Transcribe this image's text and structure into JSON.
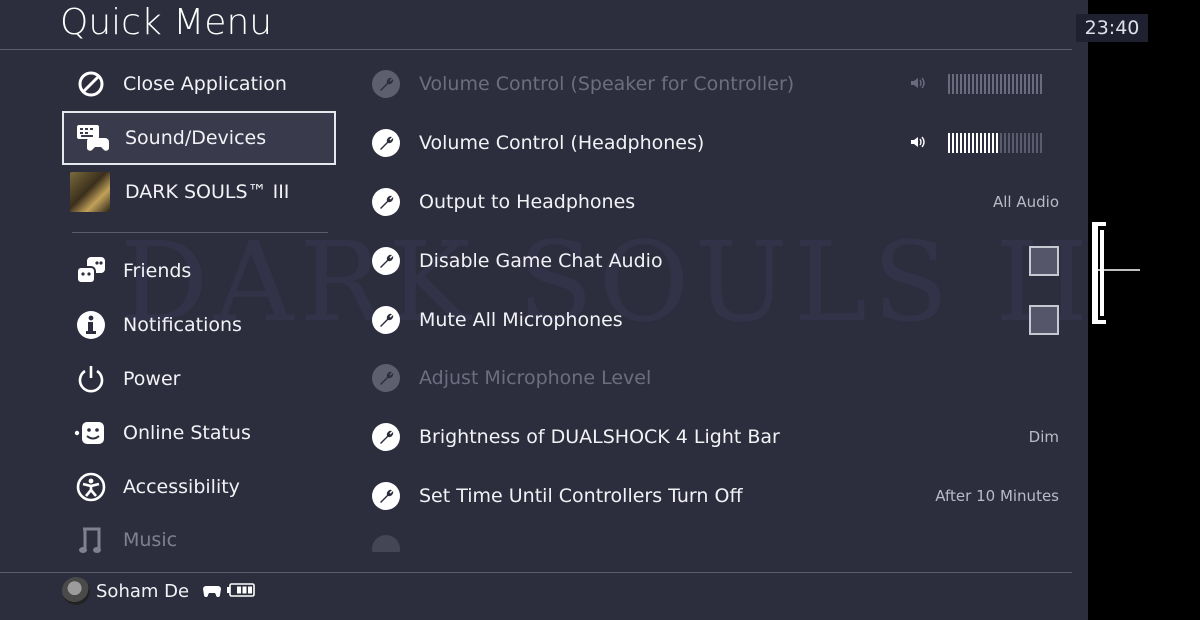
{
  "header": {
    "title": "Quick Menu",
    "clock": "23:40"
  },
  "background": {
    "watermark": "DARK SOULS III"
  },
  "left_menu": {
    "items": [
      {
        "label": "Close Application",
        "icon": "prohibited-circle-icon"
      },
      {
        "label": "Sound/Devices",
        "icon": "keyboard-controller-icon",
        "selected": true
      },
      {
        "label": "DARK SOULS™ III",
        "icon": "game-thumbnail"
      },
      {
        "label": "Friends",
        "icon": "friends-icon"
      },
      {
        "label": "Notifications",
        "icon": "info-icon"
      },
      {
        "label": "Power",
        "icon": "power-icon"
      },
      {
        "label": "Online Status",
        "icon": "online-status-icon"
      },
      {
        "label": "Accessibility",
        "icon": "accessibility-icon"
      },
      {
        "label": "Music",
        "icon": "music-note-icon"
      }
    ]
  },
  "settings": {
    "rows": [
      {
        "label": "Volume Control (Speaker for Controller)",
        "enabled": false,
        "volume_level": 0.0,
        "bars": 24
      },
      {
        "label": "Volume Control (Headphones)",
        "enabled": true,
        "volume_level": 0.54,
        "bars": 24
      },
      {
        "label": "Output to Headphones",
        "enabled": true,
        "value": "All Audio"
      },
      {
        "label": "Disable Game Chat Audio",
        "enabled": true,
        "checked": false
      },
      {
        "label": "Mute All Microphones",
        "enabled": true,
        "checked": false
      },
      {
        "label": "Adjust Microphone Level",
        "enabled": false
      },
      {
        "label": "Brightness of DUALSHOCK 4 Light Bar",
        "enabled": true,
        "value": "Dim"
      },
      {
        "label": "Set Time Until Controllers Turn Off",
        "enabled": true,
        "value": "After 10 Minutes"
      }
    ]
  },
  "footer": {
    "username": "Soham De",
    "controller_icon": "gamepad-icon",
    "battery_icon": "battery-icon",
    "battery_level": 0.75
  },
  "colors": {
    "panel_bg": "#2d2e3d",
    "text": "#f2f2f6",
    "disabled_text": "#6c6d7e"
  }
}
